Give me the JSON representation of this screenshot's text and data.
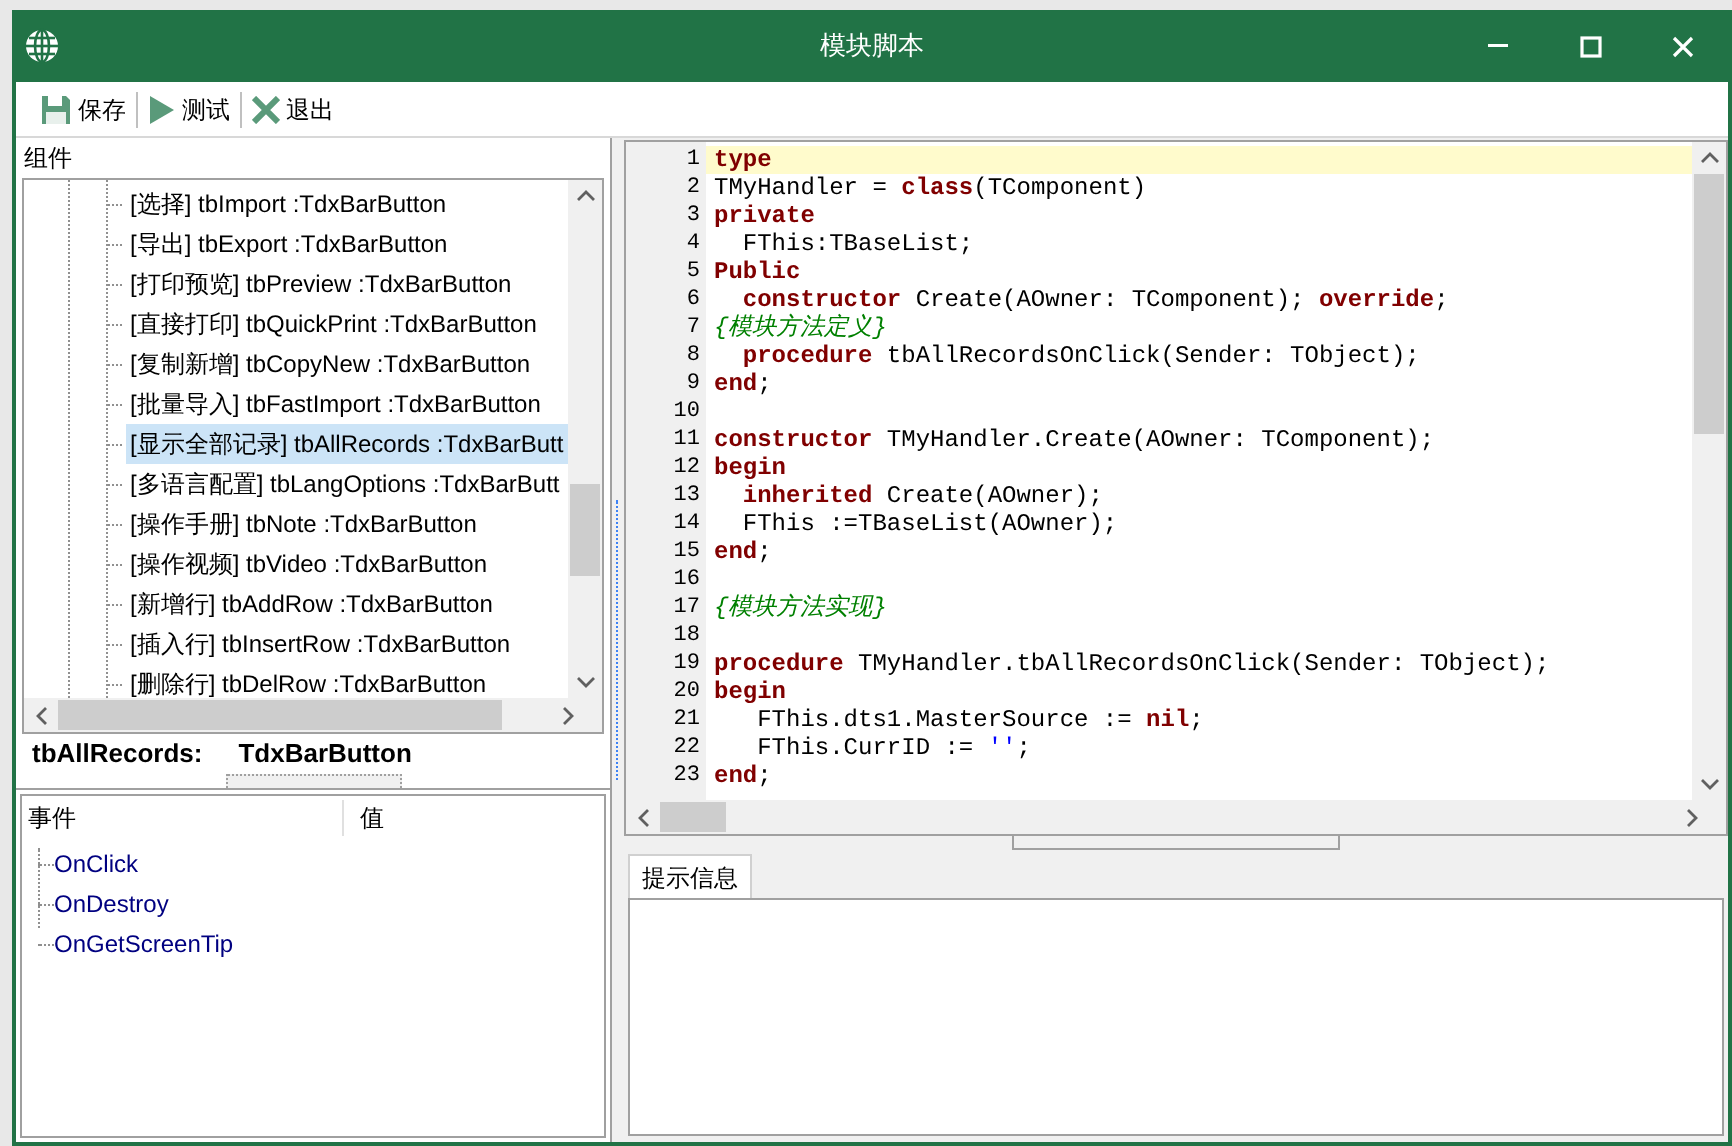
{
  "window": {
    "title": "模块脚本"
  },
  "toolbar": [
    {
      "label": "保存",
      "kind": "save"
    },
    {
      "label": "测试",
      "kind": "run"
    },
    {
      "label": "退出",
      "kind": "exit"
    }
  ],
  "components_panel": {
    "label": "组件",
    "tree": [
      {
        "label": "[选择] tbImport :TdxBarButton",
        "selected": false
      },
      {
        "label": "[导出] tbExport :TdxBarButton",
        "selected": false
      },
      {
        "label": "[打印预览] tbPreview :TdxBarButton",
        "selected": false
      },
      {
        "label": "[直接打印] tbQuickPrint :TdxBarButton",
        "selected": false
      },
      {
        "label": "[复制新增] tbCopyNew :TdxBarButton",
        "selected": false
      },
      {
        "label": "[批量导入] tbFastImport :TdxBarButton",
        "selected": false
      },
      {
        "label": "[显示全部记录] tbAllRecords :TdxBarButt",
        "selected": true
      },
      {
        "label": "[多语言配置] tbLangOptions :TdxBarButt",
        "selected": false
      },
      {
        "label": "[操作手册] tbNote :TdxBarButton",
        "selected": false
      },
      {
        "label": "[操作视频] tbVideo :TdxBarButton",
        "selected": false
      },
      {
        "label": "[新增行] tbAddRow :TdxBarButton",
        "selected": false
      },
      {
        "label": "[插入行] tbInsertRow :TdxBarButton",
        "selected": false
      },
      {
        "label": "[删除行] tbDelRow :TdxBarButton",
        "selected": false
      }
    ],
    "selection": {
      "name": "tbAllRecords:",
      "type": "TdxBarButton"
    }
  },
  "events": {
    "columns": [
      "事件",
      "值"
    ],
    "items": [
      "OnClick",
      "OnDestroy",
      "OnGetScreenTip"
    ]
  },
  "editor": {
    "lines": [
      {
        "number": "1",
        "current": true,
        "tokens": [
          {
            "kind": "kw",
            "text": "type"
          }
        ]
      },
      {
        "number": "2",
        "current": false,
        "tokens": [
          {
            "kind": "text",
            "text": "TMyHandler = "
          },
          {
            "kind": "kw",
            "text": "class"
          },
          {
            "kind": "text",
            "text": "(TComponent)"
          }
        ]
      },
      {
        "number": "3",
        "current": false,
        "tokens": [
          {
            "kind": "kw",
            "text": "private"
          }
        ]
      },
      {
        "number": "4",
        "current": false,
        "tokens": [
          {
            "kind": "text",
            "text": "  FThis:TBaseList;"
          }
        ]
      },
      {
        "number": "5",
        "current": false,
        "tokens": [
          {
            "kind": "kw",
            "text": "Public"
          }
        ]
      },
      {
        "number": "6",
        "current": false,
        "tokens": [
          {
            "kind": "kw",
            "text": "  constructor"
          },
          {
            "kind": "text",
            "text": " Create(AOwner: TComponent); "
          },
          {
            "kind": "kw",
            "text": "override"
          },
          {
            "kind": "text",
            "text": ";"
          }
        ]
      },
      {
        "number": "7",
        "current": false,
        "tokens": [
          {
            "kind": "comment",
            "text": "{模块方法定义}"
          }
        ]
      },
      {
        "number": "8",
        "current": false,
        "tokens": [
          {
            "kind": "kw",
            "text": "  procedure"
          },
          {
            "kind": "text",
            "text": " tbAllRecordsOnClick(Sender: TObject);"
          }
        ]
      },
      {
        "number": "9",
        "current": false,
        "tokens": [
          {
            "kind": "kw",
            "text": "end"
          },
          {
            "kind": "text",
            "text": ";"
          }
        ]
      },
      {
        "number": "10",
        "current": false
      },
      {
        "number": "11",
        "current": false,
        "tokens": [
          {
            "kind": "kw",
            "text": "constructor"
          },
          {
            "kind": "text",
            "text": " TMyHandler.Create(AOwner: TComponent);"
          }
        ]
      },
      {
        "number": "12",
        "current": false,
        "tokens": [
          {
            "kind": "kw",
            "text": "begin"
          }
        ]
      },
      {
        "number": "13",
        "current": false,
        "tokens": [
          {
            "kind": "kw",
            "text": "  inherited"
          },
          {
            "kind": "text",
            "text": " Create(AOwner);"
          }
        ]
      },
      {
        "number": "14",
        "current": false,
        "tokens": [
          {
            "kind": "text",
            "text": "  FThis :=TBaseList(AOwner);"
          }
        ]
      },
      {
        "number": "15",
        "current": false,
        "tokens": [
          {
            "kind": "kw",
            "text": "end"
          },
          {
            "kind": "text",
            "text": ";"
          }
        ]
      },
      {
        "number": "16",
        "current": false
      },
      {
        "number": "17",
        "current": false,
        "tokens": [
          {
            "kind": "comment",
            "text": "{模块方法实现}"
          }
        ]
      },
      {
        "number": "18",
        "current": false
      },
      {
        "number": "19",
        "current": false,
        "tokens": [
          {
            "kind": "kw",
            "text": "procedure"
          },
          {
            "kind": "text",
            "text": " TMyHandler.tbAllRecordsOnClick(Sender: TObject);"
          }
        ]
      },
      {
        "number": "20",
        "current": false,
        "tokens": [
          {
            "kind": "kw",
            "text": "begin"
          }
        ]
      },
      {
        "number": "21",
        "current": false,
        "tokens": [
          {
            "kind": "text",
            "text": "   FThis.dts1.MasterSource := "
          },
          {
            "kind": "kw",
            "text": "nil"
          },
          {
            "kind": "text",
            "text": ";"
          }
        ]
      },
      {
        "number": "22",
        "current": false,
        "tokens": [
          {
            "kind": "text",
            "text": "   FThis.CurrID := "
          },
          {
            "kind": "str",
            "text": "''"
          },
          {
            "kind": "text",
            "text": ";"
          }
        ]
      },
      {
        "number": "23",
        "current": false,
        "tokens": [
          {
            "kind": "kw",
            "text": "end"
          },
          {
            "kind": "text",
            "text": ";"
          }
        ]
      }
    ]
  },
  "hint_tab": {
    "label": "提示信息"
  }
}
